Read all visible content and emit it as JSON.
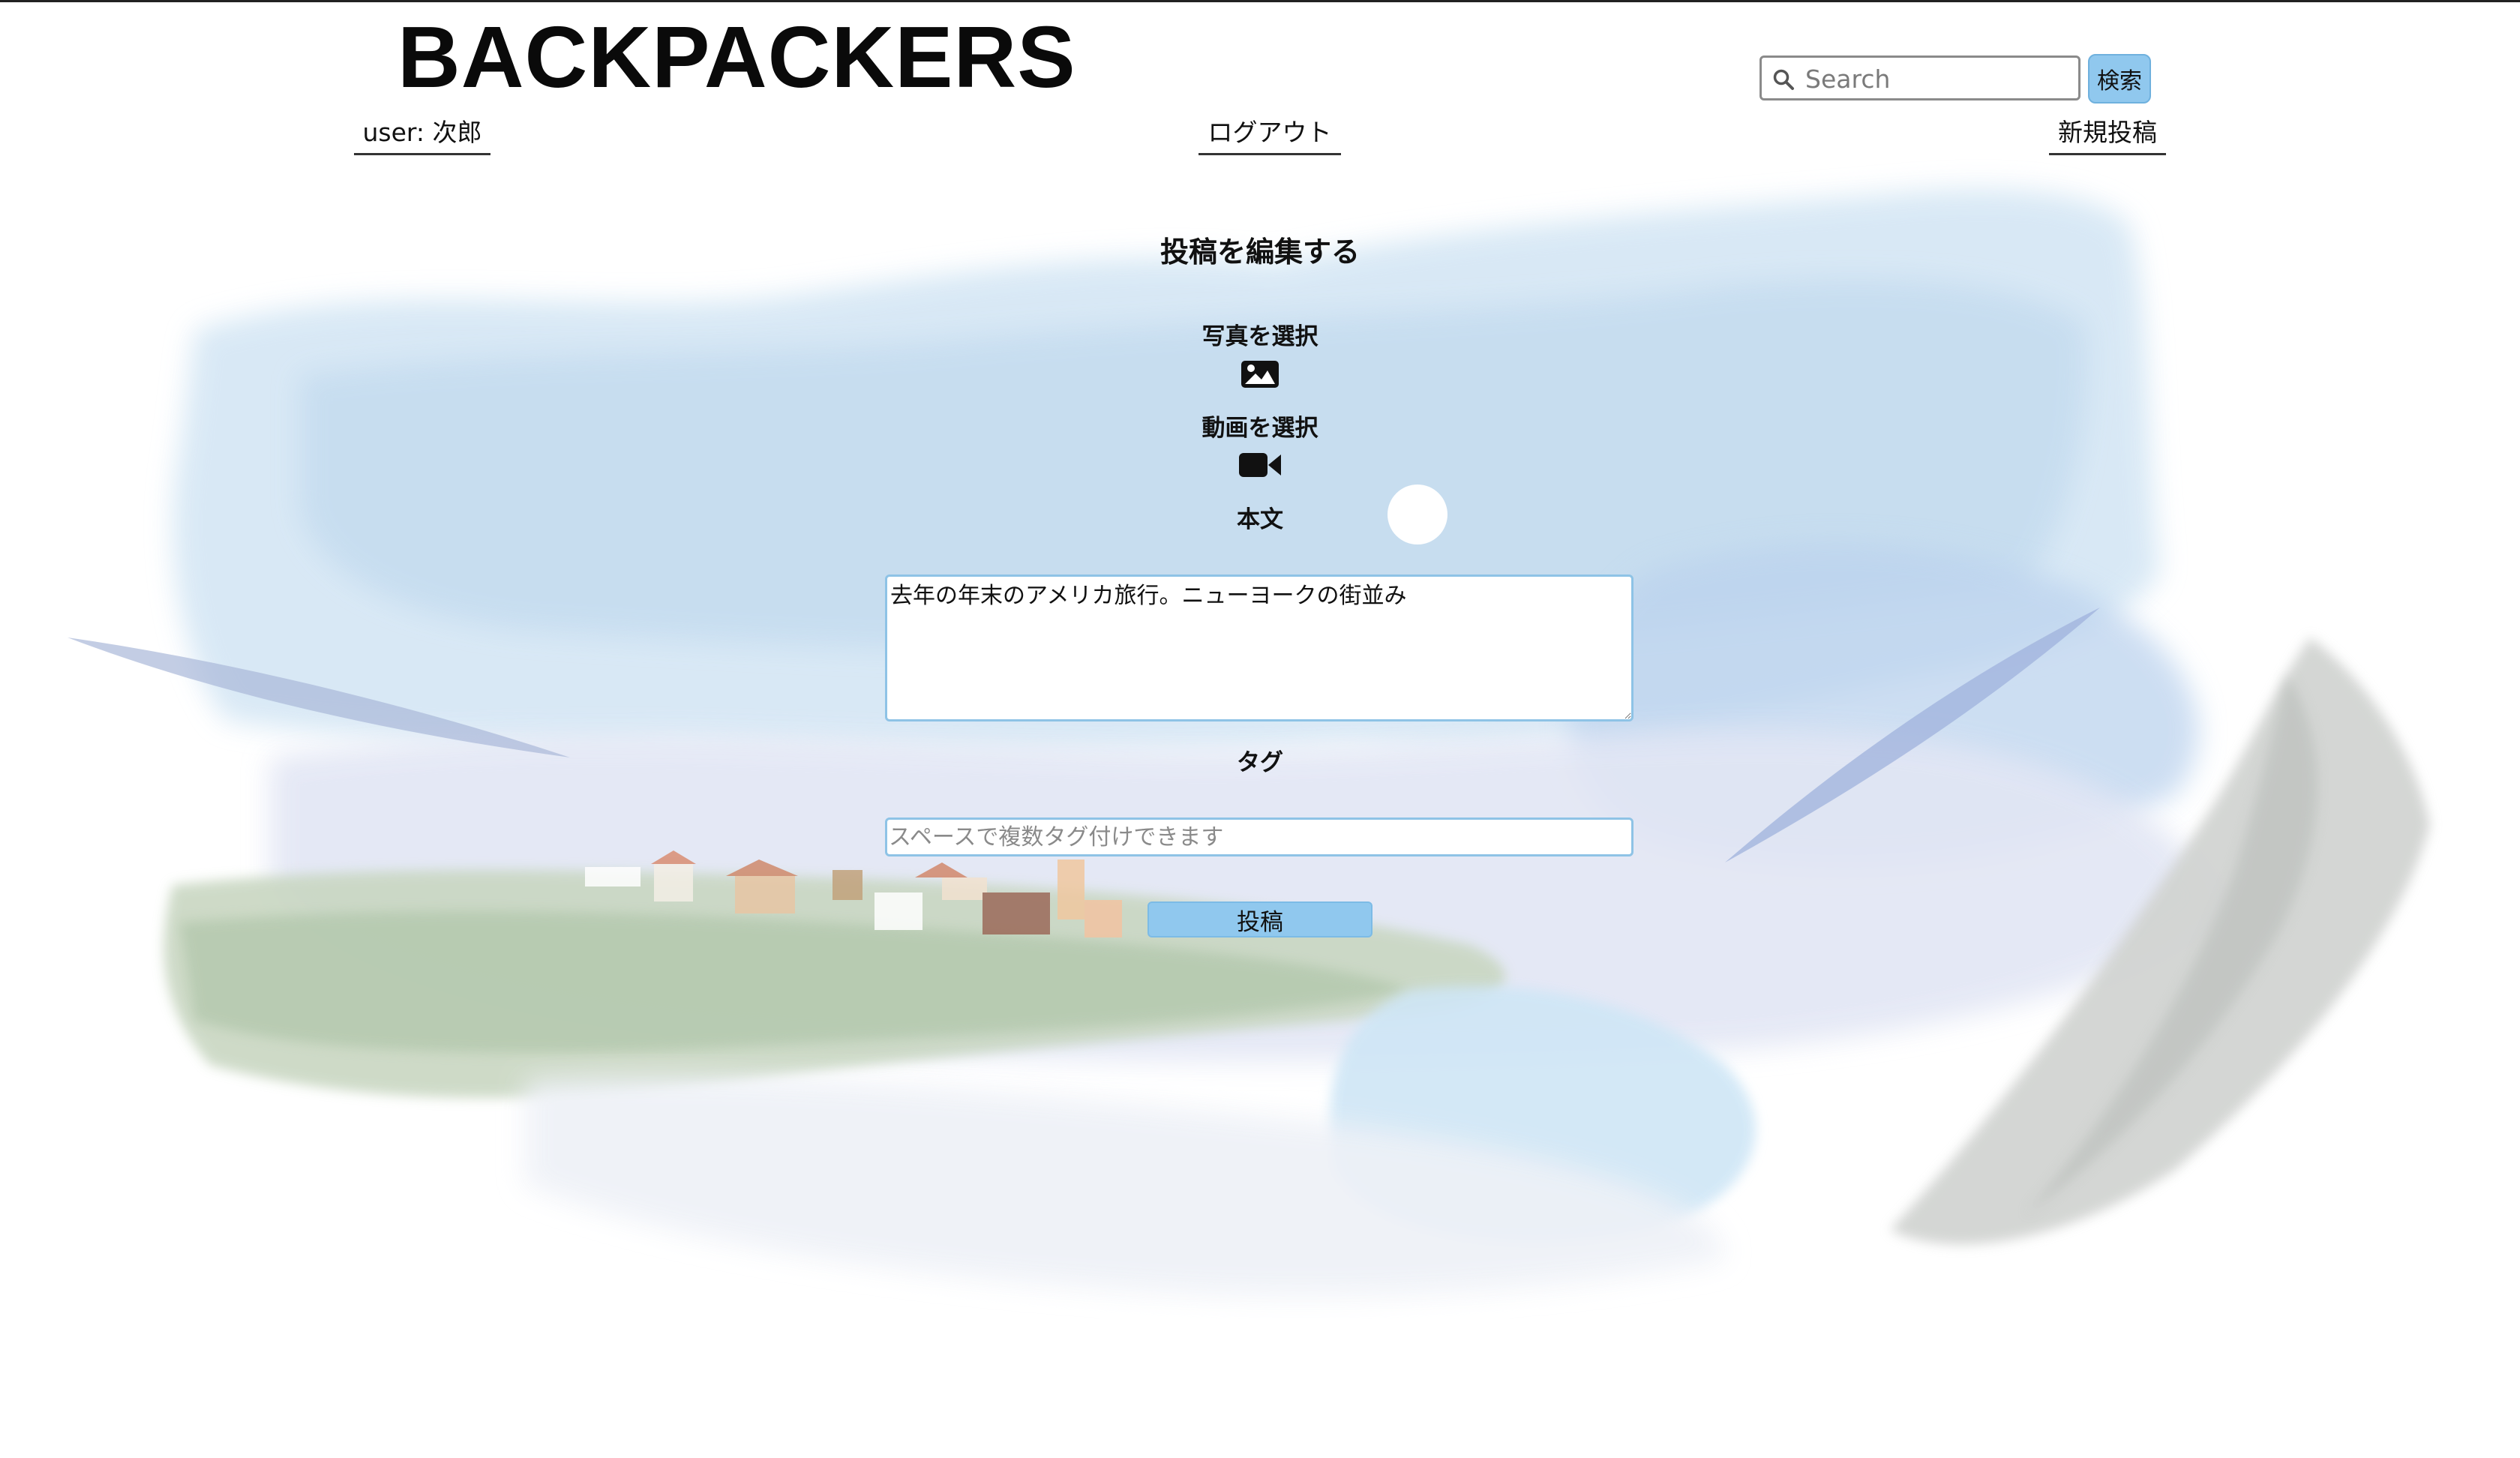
{
  "header": {
    "logo": "BACKPACKERS",
    "search": {
      "placeholder": "Search",
      "value": "",
      "button_label": "検索"
    }
  },
  "nav": {
    "user_label": "user: 次郎",
    "logout_label": "ログアウト",
    "new_post_label": "新規投稿"
  },
  "form": {
    "title": "投稿を編集する",
    "photo_label": "写真を選択",
    "photo_icon": "image-icon",
    "video_label": "動画を選択",
    "video_icon": "video-camera-icon",
    "body_label": "本文",
    "body_value": "去年の年末のアメリカ旅行。ニューヨークの街並み",
    "tag_label": "タグ",
    "tag_placeholder": "スペースで複数タグ付けできます",
    "tag_value": "",
    "submit_label": "投稿"
  },
  "colors": {
    "accent_button": "#90c8ee",
    "input_border": "#8ec3e6",
    "text": "#111111"
  }
}
